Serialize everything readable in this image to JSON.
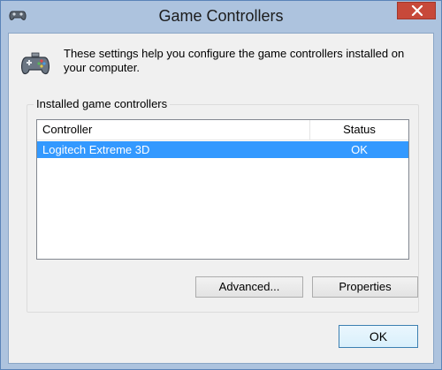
{
  "window": {
    "title": "Game Controllers",
    "icon": "gamepad-icon",
    "close_icon": "close-icon",
    "colors": {
      "frame": "#adc3de",
      "close": "#c7493a",
      "selection": "#3399ff"
    }
  },
  "header": {
    "icon": "gamepad-icon",
    "description": "These settings help you configure the game controllers installed on your computer."
  },
  "group": {
    "label": "Installed game controllers",
    "columns": {
      "controller": "Controller",
      "status": "Status"
    },
    "rows": [
      {
        "controller": "Logitech Extreme 3D",
        "status": "OK",
        "selected": true
      }
    ]
  },
  "buttons": {
    "advanced": "Advanced...",
    "properties": "Properties",
    "ok": "OK"
  }
}
